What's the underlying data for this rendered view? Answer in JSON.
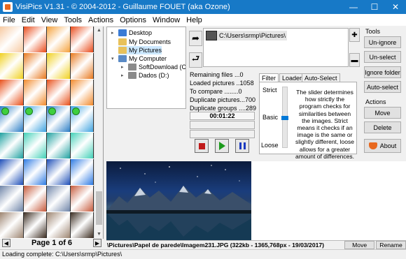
{
  "window": {
    "title": "VisiPics V1.31 - © 2004-2012 - Guillaume FOUET (aka Ozone)",
    "minimize": "—",
    "maximize": "☐",
    "close": "✕"
  },
  "menu": [
    "File",
    "Edit",
    "View",
    "Tools",
    "Actions",
    "Options",
    "Window",
    "Help"
  ],
  "thumbnails": {
    "rows": [
      {
        "colors": [
          "#f7c9a0",
          "#e94b1b",
          "#f5a13b",
          "#e94b1b"
        ],
        "marked": false
      },
      {
        "colors": [
          "#f0d020",
          "#e8781d",
          "#f0d020",
          "#e8781d"
        ],
        "marked": false
      },
      {
        "colors": [
          "#e8501a",
          "#f28a2c",
          "#e8501a",
          "#f28a2c"
        ],
        "marked": false
      },
      {
        "colors": [
          "#2a7dc5",
          "#3fa3e0",
          "#2a7dc5",
          "#3fa3e0"
        ],
        "marked": true
      },
      {
        "colors": [
          "#1fa0a0",
          "#42d0b8",
          "#1fa0a0",
          "#42d0b8"
        ],
        "marked": false
      },
      {
        "colors": [
          "#1e4fb8",
          "#2f7be3",
          "#1e4fb8",
          "#2f7be3"
        ],
        "marked": false
      },
      {
        "colors": [
          "#6e84a8",
          "#c65a3c",
          "#6e84a8",
          "#c65a3c"
        ],
        "marked": false
      },
      {
        "colors": [
          "#9c8470",
          "#3b2c20",
          "#9c8470",
          "#3b2c20"
        ],
        "marked": false
      }
    ],
    "page_label": "Page 1 of 6"
  },
  "tree": {
    "items": [
      {
        "label": "Desktop",
        "icon_color": "#3a7bd5",
        "selected": false,
        "has_caret": false,
        "level": 0
      },
      {
        "label": "My Documents",
        "icon_color": "#e8c15a",
        "selected": false,
        "has_caret": false,
        "level": 0
      },
      {
        "label": "My Pictures",
        "icon_color": "#e8c15a",
        "selected": true,
        "has_caret": false,
        "level": 0
      },
      {
        "label": "My Computer",
        "icon_color": "#5a8ac5",
        "selected": false,
        "has_caret": true,
        "level": 0
      },
      {
        "label": "SoftDownload (C:)",
        "icon_color": "#8a8a8a",
        "selected": false,
        "has_caret": true,
        "level": 1
      },
      {
        "label": "Dados (D:)",
        "icon_color": "#8a8a8a",
        "selected": false,
        "has_caret": true,
        "level": 1
      }
    ]
  },
  "paths": {
    "items": [
      "C:\\Users\\srmp\\Pictures\\"
    ]
  },
  "stats": {
    "remaining": "Remaining files ...0",
    "loaded": "Loaded pictures ..1058",
    "to_compare": "To compare ........0",
    "duplicate_pictures": "Duplicate pictures...700",
    "duplicate_groups": "Duplicate groups ....289",
    "timer": "00:01:22"
  },
  "filter": {
    "tabs": [
      "Filter",
      "Loader",
      "Auto-Select"
    ],
    "levels": [
      "Strict",
      "Basic",
      "Loose"
    ],
    "description": "The slider determines how strictly the program checks for similarities between the images. Strict means it checks if an image is the same or slightly different, loose allows for a greater amount of differences."
  },
  "tools": {
    "title": "Tools",
    "buttons": [
      "Un-ignore",
      "Un-select",
      "Ignore folder",
      "Auto-select"
    ]
  },
  "actions": {
    "title": "Actions",
    "buttons": [
      "Move",
      "Delete",
      "About"
    ]
  },
  "preview": {
    "info": "\\Pictures\\Papel de parede\\Imagem231.JPG (322kb - 1365,768px - 19/03/2017)",
    "move": "Move",
    "rename": "Rename"
  },
  "status": "Loading complete: C:\\Users\\srmp\\Pictures\\",
  "colors": {
    "titlebar": "#1779c7",
    "accent": "#0078d7",
    "stop_red": "#c01a1a",
    "play_green": "#1a9a1a",
    "pause_blue": "#1a3ac0"
  }
}
